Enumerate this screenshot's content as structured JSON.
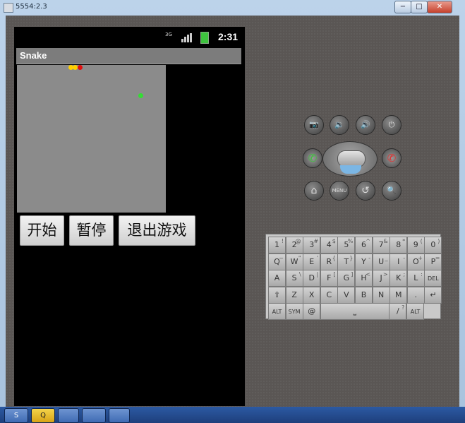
{
  "window": {
    "title": "5554:2.3",
    "minimize": "−",
    "maximize": "□",
    "close": "✕"
  },
  "status_bar": {
    "network": "3G",
    "time": "2:31"
  },
  "app": {
    "title": "Snake",
    "buttons": {
      "start": "开始",
      "pause": "暂停",
      "exit": "退出游戏"
    }
  },
  "game": {
    "snake_colors": [
      "#ffd000",
      "#ffd000",
      "#e01010"
    ],
    "food_color": "#33dd33"
  },
  "controls": {
    "camera": "📷",
    "volume_down": "🔉",
    "volume_up": "🔊",
    "power": "⏻",
    "call": "✆",
    "end_call": "✆",
    "home": "⌂",
    "menu": "MENU",
    "back": "↺",
    "search": "🔍"
  },
  "keyboard": {
    "rows": [
      [
        [
          "1",
          "!"
        ],
        [
          "2",
          "@"
        ],
        [
          "3",
          "#"
        ],
        [
          "4",
          "$"
        ],
        [
          "5",
          "%"
        ],
        [
          "6",
          "^"
        ],
        [
          "7",
          "&"
        ],
        [
          "8",
          "*"
        ],
        [
          "9",
          "("
        ],
        [
          "0",
          ")"
        ]
      ],
      [
        [
          "Q",
          "~"
        ],
        [
          "W",
          "\""
        ],
        [
          "E",
          "'"
        ],
        [
          "R",
          "{"
        ],
        [
          "T",
          "}"
        ],
        [
          "Y",
          "-"
        ],
        [
          "U",
          "_"
        ],
        [
          "I",
          "-"
        ],
        [
          "O",
          "+"
        ],
        [
          "P",
          "="
        ]
      ],
      [
        [
          "A",
          ""
        ],
        [
          "S",
          "\\"
        ],
        [
          "D",
          "|"
        ],
        [
          "F",
          "["
        ],
        [
          "G",
          "]"
        ],
        [
          "H",
          "<"
        ],
        [
          "J",
          ">"
        ],
        [
          "K",
          ";"
        ],
        [
          "L",
          ":"
        ],
        [
          "DEL",
          ""
        ]
      ],
      [
        [
          "⇧",
          ""
        ],
        [
          "Z",
          ""
        ],
        [
          "X",
          ""
        ],
        [
          "C",
          ""
        ],
        [
          "V",
          ""
        ],
        [
          "B",
          ""
        ],
        [
          "N",
          ""
        ],
        [
          "M",
          ""
        ],
        [
          ".",
          ""
        ],
        [
          "↵",
          ""
        ]
      ],
      [
        [
          "ALT",
          ""
        ],
        [
          "SYM",
          ""
        ],
        [
          "@",
          ""
        ],
        [
          "⎵",
          ""
        ],
        [
          "/",
          "?"
        ],
        [
          "ALT",
          ""
        ]
      ]
    ]
  },
  "taskbar": {
    "items": [
      "S",
      "Q",
      "",
      "",
      ""
    ]
  }
}
